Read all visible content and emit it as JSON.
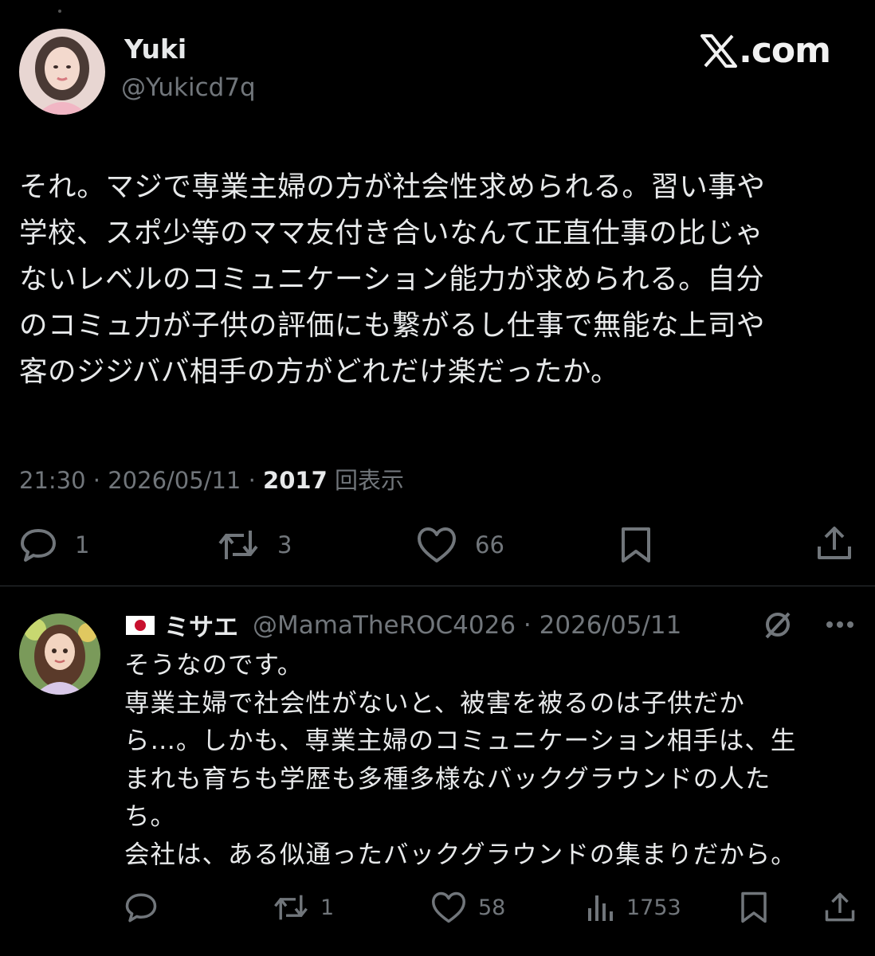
{
  "tweet": {
    "display_name": "Yuki",
    "handle": "@Yukicd7q",
    "brand": ".com",
    "text": "それ。マジで専業主婦の方が社会性求められる。習い事や\n学校、スポ少等のママ友付き合いなんて正直仕事の比じゃ\nないレベルのコミュニケーション能力が求められる。自分\nのコミュ力が子供の評価にも繋がるし仕事で無能な上司や\n客のジジババ相手の方がどれだけ楽だったか。",
    "time": "21:30",
    "sep1": " · ",
    "date": "2026/05/11",
    "sep2": " · ",
    "view_count": "2017",
    "view_label": " 回表示",
    "actions": {
      "replies": "1",
      "retweets": "3",
      "likes": "66"
    },
    "avatar_icon": "user-avatar-icon"
  },
  "reply": {
    "flag_icon": "japan-flag-icon",
    "display_name": "ミサエ",
    "handle": "@MamaTheROC4026",
    "sep": " · ",
    "date": "2026/05/11",
    "text": "そうなのです。\n専業主婦で社会性がないと、被害を被るのは子供だか\nら…。しかも、専業主婦のコミュニケーション相手は、生\nまれも育ちも学歴も多種多様なバックグラウンドの人た\nち。\n会社は、ある似通ったバックグラウンドの集まりだから。",
    "actions": {
      "retweets": "1",
      "likes": "58",
      "views": "1753"
    },
    "avatar_icon": "user-avatar-icon"
  },
  "colors": {
    "background": "#000000",
    "text": "#e7e9ea",
    "muted": "#71767b",
    "divider": "#2f3336"
  }
}
